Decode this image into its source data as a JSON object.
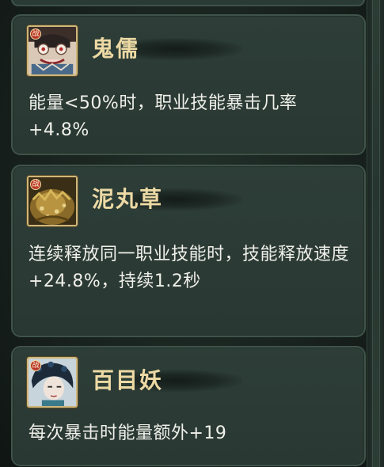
{
  "cards": [
    {
      "name": "鬼儒",
      "tier_badge": "战",
      "portrait_icon": "ghost-scholar-portrait-icon",
      "description": "能量<50%时，职业技能暴击几率+4.8%"
    },
    {
      "name": "泥丸草",
      "tier_badge": "战",
      "portrait_icon": "mud-grass-portrait-icon",
      "description": "连续释放同一职业技能时，技能释放速度+24.8%，持续1.2秒"
    },
    {
      "name": "百目妖",
      "tier_badge": "战",
      "portrait_icon": "hundred-eyes-portrait-icon",
      "description": "每次暴击时能量额外+19"
    }
  ],
  "colors": {
    "card_bg": "#2d3d37",
    "card_border": "#3f544b",
    "name_color": "#ecd9a4",
    "text_color": "#f0f0ea",
    "portrait_frame": "#cfb77a"
  }
}
